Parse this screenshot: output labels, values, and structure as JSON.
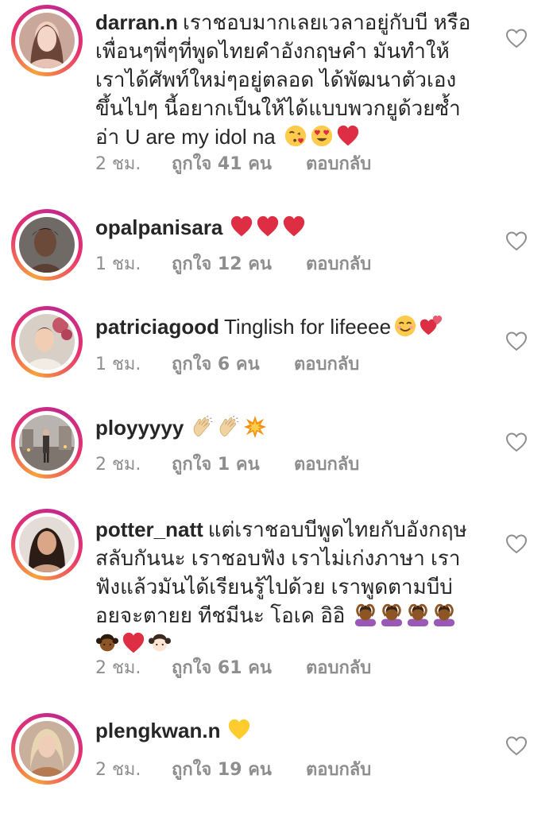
{
  "comments": [
    {
      "username": "darran.n",
      "text_lines": [
        "เราชอบมากเลยเวลาอยู่กับบี หรือ",
        "เพื่อนๆพี่ๆที่พูดไทยคำอังกฤษคำ มันทำให้",
        "เราได้ศัพท์ใหม่ๆอยู่ตลอด ได้พัฒนาตัวเอง",
        "ขึ้นไปๆ นี้อยากเป็นให้ได้แบบพวกยูด้วยซ้ำ",
        "อ่า U are my idol na"
      ],
      "emojis": [
        "kissing-heart-emoji",
        "heart-eyes-emoji",
        "red-heart-emoji"
      ],
      "time": "2 ชม.",
      "likes": "ถูกใจ 41 คน",
      "reply": "ตอบกลับ"
    },
    {
      "username": "opalpanisara",
      "text_lines": [
        ""
      ],
      "emojis": [
        "red-heart-emoji",
        "red-heart-emoji",
        "red-heart-emoji"
      ],
      "time": "1 ชม.",
      "likes": "ถูกใจ 12 คน",
      "reply": "ตอบกลับ"
    },
    {
      "username": "patriciagood",
      "text_lines": [
        "Tinglish for lifeeee"
      ],
      "emojis": [
        "smiling-emoji",
        "two-hearts-emoji"
      ],
      "time": "1 ชม.",
      "likes": "ถูกใจ 6 คน",
      "reply": "ตอบกลับ"
    },
    {
      "username": "ployyyyy",
      "text_lines": [
        ""
      ],
      "emojis": [
        "clapping-hands-emoji",
        "clapping-hands-emoji",
        "collision-emoji"
      ],
      "time": "2 ชม.",
      "likes": "ถูกใจ 1 คน",
      "reply": "ตอบกลับ"
    },
    {
      "username": "potter_natt",
      "text_lines": [
        "แต่เราชอบบีพูดไทยกับอังกฤษ",
        "สลับกันนะ เราชอบฟัง เราไม่เก่งภาษา เรา",
        "ฟังแล้วมันได้เรียนรู้ไปด้วย เราพูดตามบีบ่",
        "อยจะตายย ทีชมีนะ โอเค อิอิ"
      ],
      "emojis": [
        "person-gesturing-ok-emoji",
        "person-gesturing-ok-emoji",
        "person-gesturing-ok-emoji",
        "person-gesturing-ok-emoji"
      ],
      "emojis_line2": [
        "girl-dark-emoji",
        "red-heart-emoji",
        "girl-light-emoji"
      ],
      "time": "2 ชม.",
      "likes": "ถูกใจ 61 คน",
      "reply": "ตอบกลับ"
    },
    {
      "username": "plengkwan.n",
      "text_lines": [
        ""
      ],
      "emojis": [
        "yellow-heart-emoji"
      ],
      "time": "2 ชม.",
      "likes": "ถูกใจ 19 คน",
      "reply": "ตอบกลับ"
    }
  ],
  "colors": {
    "text": "#262626",
    "meta": "#8e8e8e",
    "ring_start": "#f7a23a",
    "ring_end": "#c0298e"
  }
}
